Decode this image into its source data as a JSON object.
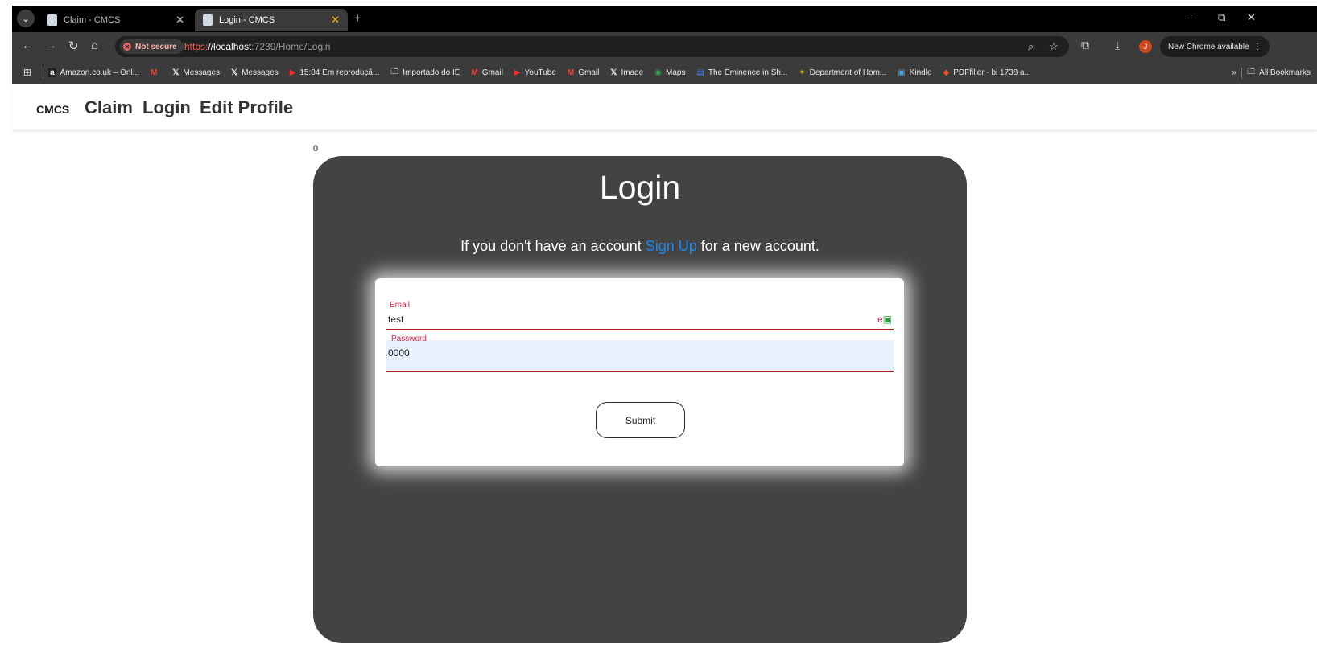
{
  "browser": {
    "tabs": [
      {
        "title": "Claim - CMCS",
        "active": false
      },
      {
        "title": "Login - CMCS",
        "active": true
      }
    ],
    "url": {
      "scheme": "https:",
      "host": "//localhost",
      "rest": ":7239/Home/Login"
    },
    "security_label": "Not secure",
    "new_chrome_label": "New Chrome available",
    "avatar_initial": "J",
    "bookmarks": [
      {
        "label": "Amazon.co.uk – Onl...",
        "icon": "amazon-icon"
      },
      {
        "label": "",
        "icon": "gmail-icon"
      },
      {
        "label": "Messages",
        "icon": "x-icon"
      },
      {
        "label": "Messages",
        "icon": "x-icon"
      },
      {
        "label": "15:04 Em reproduçã...",
        "icon": "youtube-icon"
      },
      {
        "label": "Importado do IE",
        "icon": "folder-icon"
      },
      {
        "label": "Gmail",
        "icon": "gmail-icon"
      },
      {
        "label": "YouTube",
        "icon": "youtube-icon"
      },
      {
        "label": "Gmail",
        "icon": "gmail-icon"
      },
      {
        "label": "Image",
        "icon": "x-icon"
      },
      {
        "label": "Maps",
        "icon": "maps-icon"
      },
      {
        "label": "The Eminence in Sh...",
        "icon": "doc-icon"
      },
      {
        "label": "Department of Hom...",
        "icon": "globe-icon"
      },
      {
        "label": "Kindle",
        "icon": "kindle-icon"
      },
      {
        "label": "PDFfiller - bi 1738 a...",
        "icon": "pdffiller-icon"
      }
    ],
    "all_bookmarks_label": "All Bookmarks"
  },
  "nav": {
    "brand": "CMCS",
    "links": [
      "Claim",
      "Login",
      "Edit Profile"
    ]
  },
  "page": {
    "counter": "0",
    "title": "Login",
    "signup_prefix": "If you don't have an account ",
    "signup_link": "Sign Up",
    "signup_suffix": " for a new account.",
    "form": {
      "email_label": "Email",
      "email_value": "test",
      "password_label": "Password",
      "password_value": "0000",
      "submit_label": "Submit"
    }
  },
  "colors": {
    "card_bg": "#434343",
    "link": "#1e87f0",
    "label": "#d6254d",
    "field_underline": "#a4232b"
  }
}
